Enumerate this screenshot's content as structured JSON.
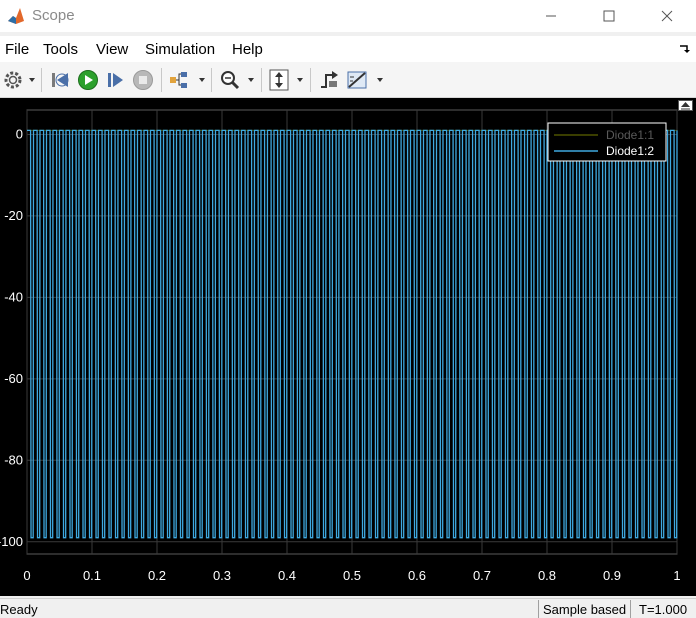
{
  "window": {
    "title": "Scope"
  },
  "menu": {
    "items": [
      "File",
      "Tools",
      "View",
      "Simulation",
      "Help"
    ]
  },
  "toolbar": {
    "icons": [
      "gear-icon",
      "step-back-icon",
      "run-icon",
      "step-forward-icon",
      "stop-icon",
      "signal-tree-icon",
      "zoom-icon",
      "scale-axes-icon",
      "triggers-icon",
      "measurements-icon"
    ]
  },
  "chart_data": {
    "type": "line",
    "xlim": [
      0,
      1
    ],
    "ylim": [
      -103,
      6
    ],
    "xticks": [
      "0",
      "0.1",
      "0.2",
      "0.3",
      "0.4",
      "0.5",
      "0.6",
      "0.7",
      "0.8",
      "0.9",
      "1"
    ],
    "yticks": [
      "0",
      "-20",
      "-40",
      "-60",
      "-80",
      "-100"
    ],
    "grid": true,
    "legend_position": "top-right",
    "series": [
      {
        "name": "Diode1:1",
        "color": "#4d5200",
        "values_note_hidden": false,
        "high": 1,
        "low": 1
      },
      {
        "name": "Diode1:2",
        "color": "#3fa9e0",
        "high": 1,
        "low": -99,
        "cycles": 100
      }
    ],
    "colors": {
      "background": "#000000",
      "grid": "#3a3a3a",
      "axis_text": "#ffffff",
      "legend_border": "#ffffff"
    }
  },
  "status": {
    "left": "Ready",
    "mode": "Sample based",
    "time": "T=1.000"
  }
}
